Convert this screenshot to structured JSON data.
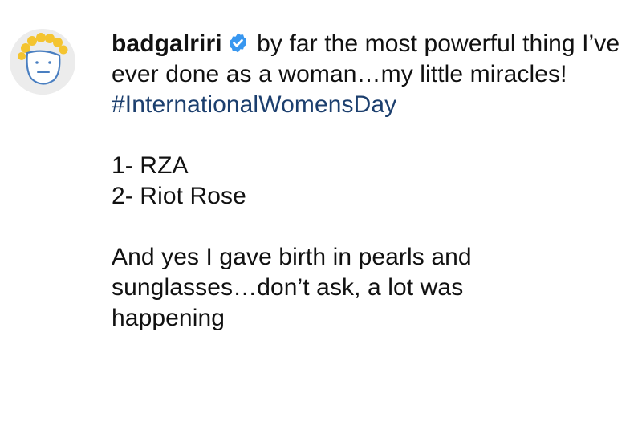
{
  "post": {
    "username": "badgalriri",
    "avatar_icon": "smiley-sun-doodle-avatar",
    "verified_icon": "verified-badge-icon",
    "verified_color": "#3897f0",
    "hashtag_color": "#1c3f6e",
    "caption": {
      "intro": "by far the most powerful thing I’ve ever done as a woman…my little miracles!",
      "hashtag": "#InternationalWomensDay",
      "list": [
        "1- RZA",
        "2- Riot Rose"
      ],
      "closing_line_1": "And yes I gave birth in pearls and",
      "closing_line_2": "sunglasses…don’t ask, a lot was",
      "closing_line_3": "happening"
    }
  }
}
